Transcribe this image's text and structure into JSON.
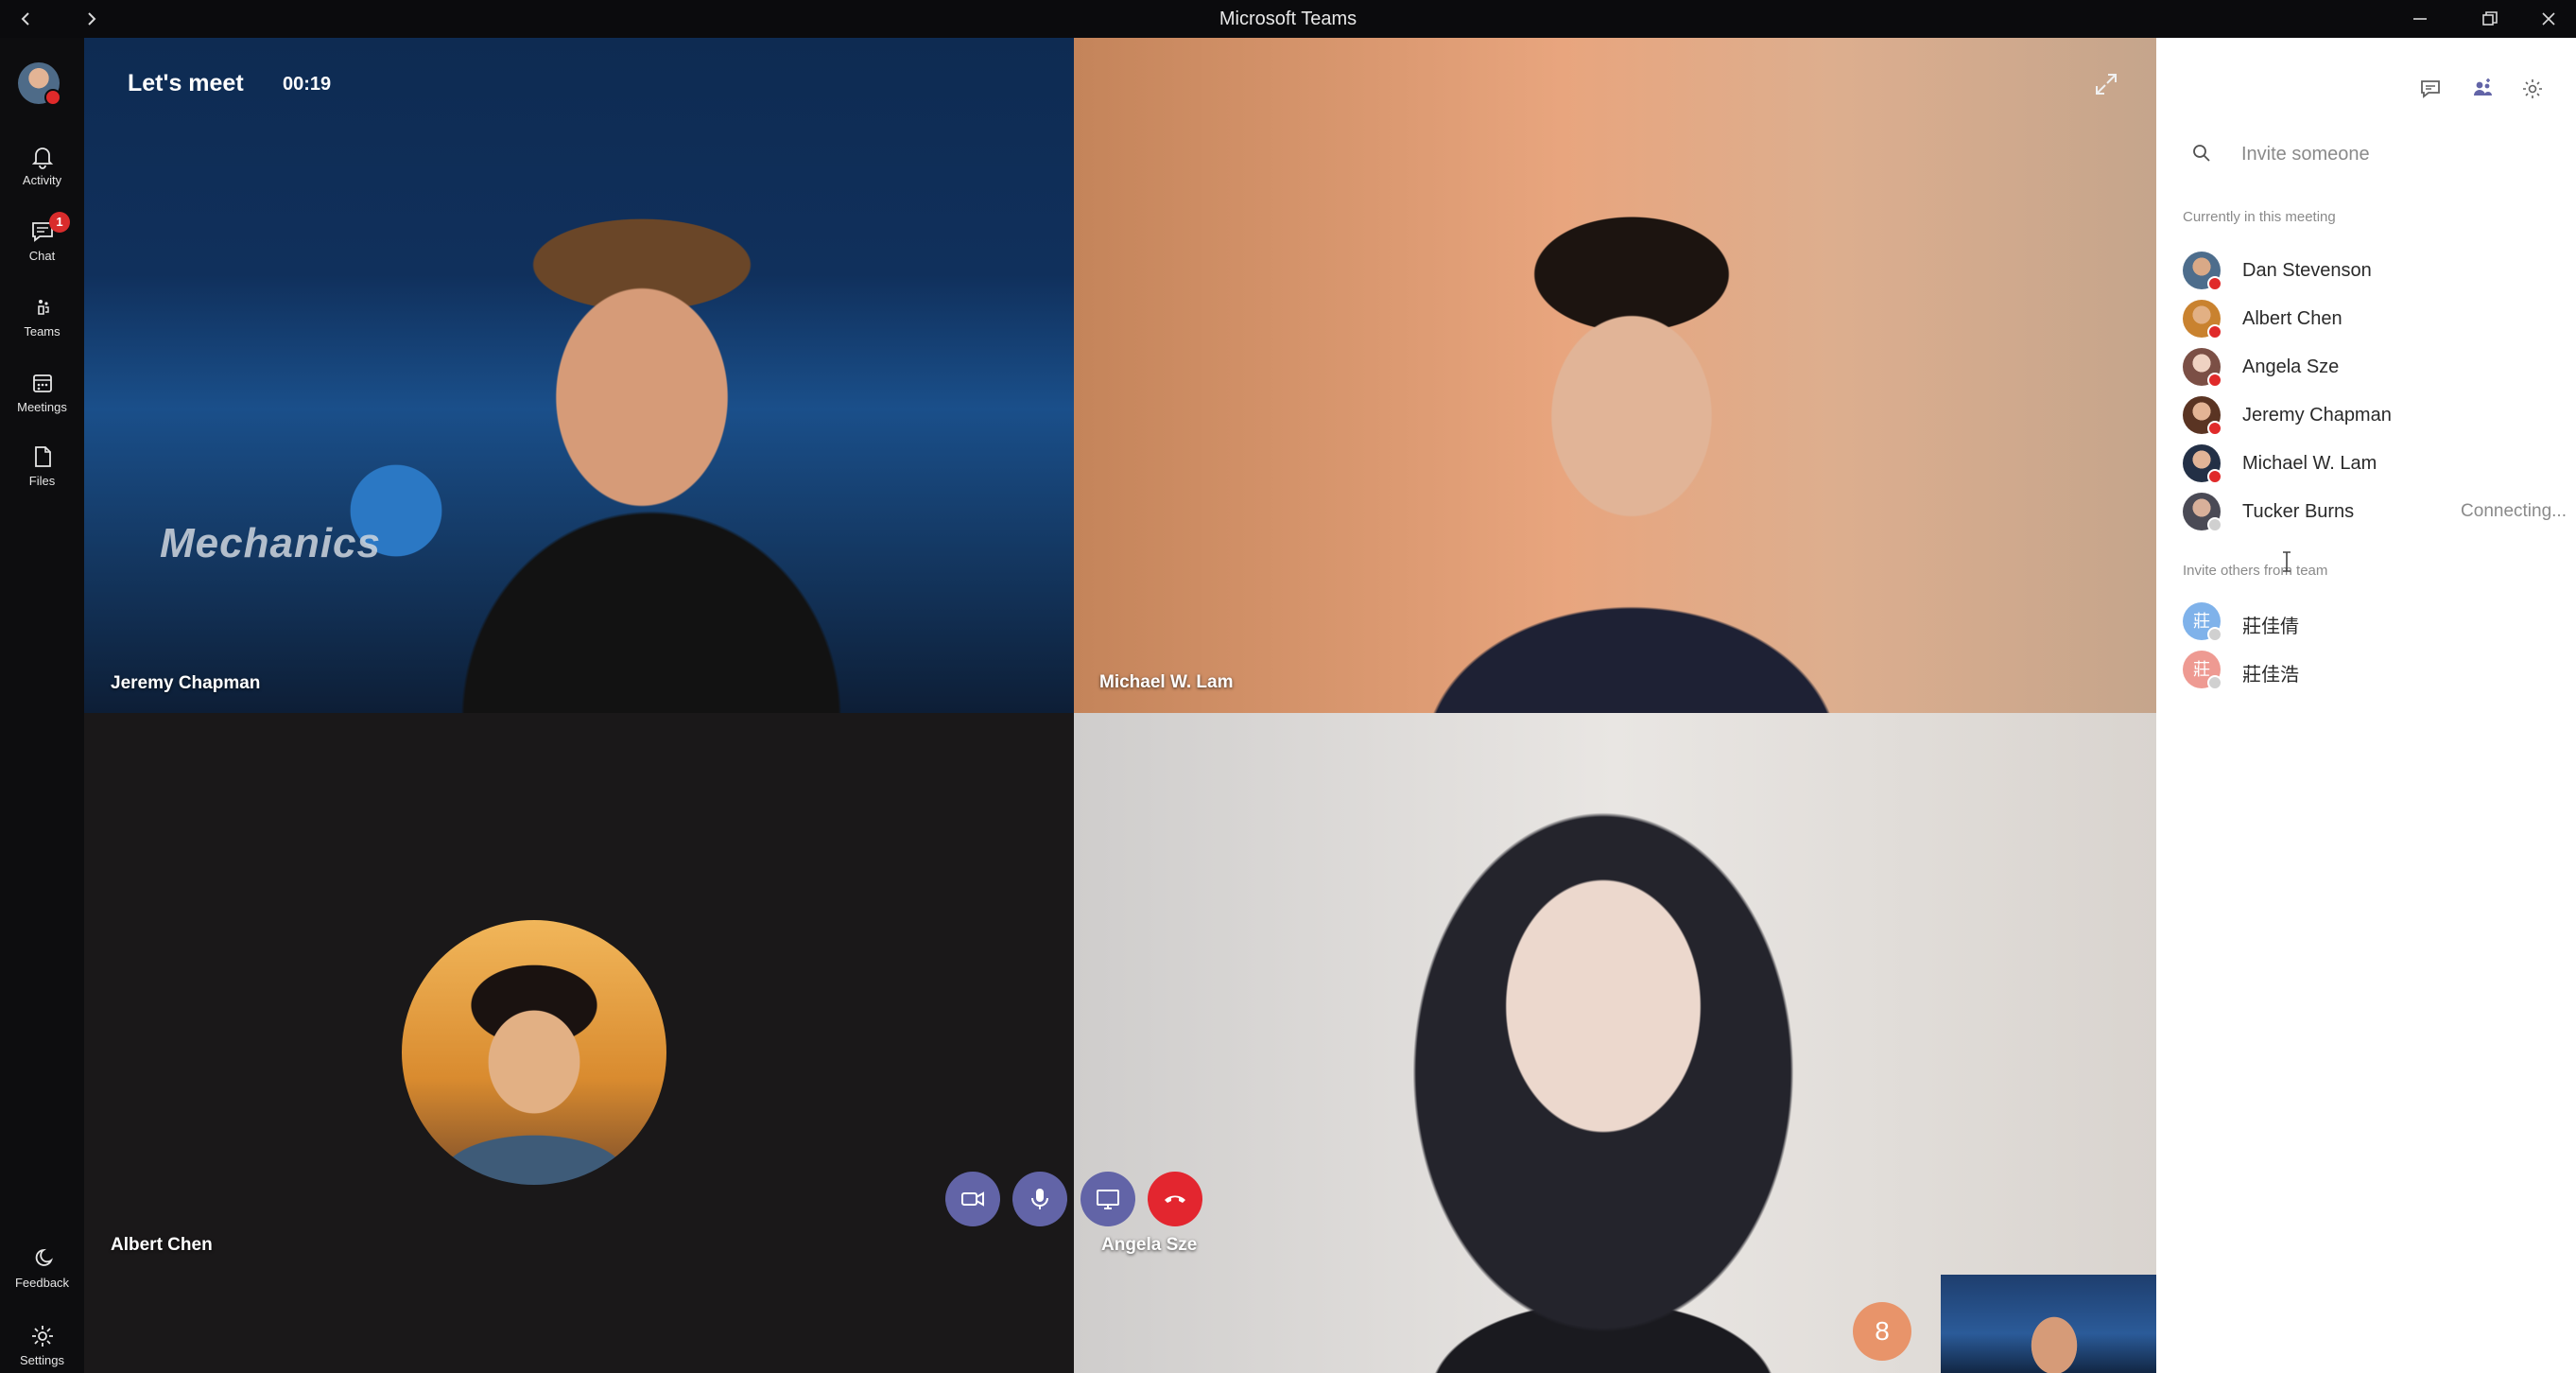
{
  "window": {
    "title": "Microsoft Teams"
  },
  "meeting": {
    "title": "Let's meet",
    "elapsed": "00:19"
  },
  "rail": {
    "items": [
      {
        "label": "Activity",
        "icon": "bell-icon"
      },
      {
        "label": "Chat",
        "icon": "chat-icon",
        "badge": "1"
      },
      {
        "label": "Teams",
        "icon": "teams-icon"
      },
      {
        "label": "Meetings",
        "icon": "calendar-icon"
      },
      {
        "label": "Files",
        "icon": "file-icon"
      }
    ],
    "bottom": [
      {
        "label": "Feedback",
        "icon": "feedback-icon"
      },
      {
        "label": "Settings",
        "icon": "gear-icon"
      }
    ]
  },
  "tiles": {
    "jeremy": {
      "name": "Jeremy Chapman",
      "background_text": "Mechanics"
    },
    "michael": {
      "name": "Michael W. Lam"
    },
    "albert": {
      "name": "Albert Chen"
    },
    "angela": {
      "name": "Angela Sze"
    }
  },
  "overflow": {
    "count": "8"
  },
  "panel": {
    "invite_placeholder": "Invite someone",
    "current_label": "Currently in this meeting",
    "participants": [
      {
        "name": "Dan Stevenson",
        "status": ""
      },
      {
        "name": "Albert Chen",
        "status": ""
      },
      {
        "name": "Angela Sze",
        "status": ""
      },
      {
        "name": "Jeremy Chapman",
        "status": ""
      },
      {
        "name": "Michael W. Lam",
        "status": ""
      },
      {
        "name": "Tucker Burns",
        "status": "Connecting..."
      }
    ],
    "invite_label": "Invite others from team",
    "team_members": [
      {
        "name": "莊佳倩",
        "initial": "莊",
        "color": "#7fb2ea"
      },
      {
        "name": "莊佳浩",
        "initial": "莊",
        "color": "#ee9a92"
      }
    ]
  },
  "colors": {
    "accent": "#6264a7",
    "hangup": "#e3262f",
    "badge": "#d92c2c"
  }
}
